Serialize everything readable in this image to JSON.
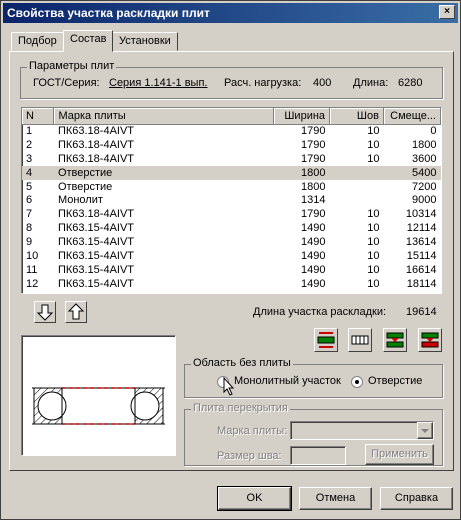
{
  "window": {
    "title": "Свойства участка раскладки плит",
    "close_label": "×"
  },
  "tabs": [
    {
      "label": "Подбор"
    },
    {
      "label": "Состав"
    },
    {
      "label": "Установки"
    }
  ],
  "params": {
    "legend": "Параметры плит",
    "gost_label": "ГОСТ/Серия:",
    "gost_value": "Серия 1.141-1 вып.",
    "load_label": "Расч. нагрузка:",
    "load_value": "400",
    "length_label": "Длина:",
    "length_value": "6280"
  },
  "table": {
    "headers": [
      "N",
      "Марка плиты",
      "Ширина",
      "Шов",
      "Смеще..."
    ],
    "rows": [
      [
        "1",
        "ПК63.18-4AIVT",
        "1790",
        "10",
        "0"
      ],
      [
        "2",
        "ПК63.18-4AIVT",
        "1790",
        "10",
        "1800"
      ],
      [
        "3",
        "ПК63.18-4AIVT",
        "1790",
        "10",
        "3600"
      ],
      [
        "4",
        "Отверстие",
        "1800",
        "",
        "5400"
      ],
      [
        "5",
        "Отверстие",
        "1800",
        "",
        "7200"
      ],
      [
        "6",
        "Монолит",
        "1314",
        "",
        "9000"
      ],
      [
        "7",
        "ПК63.18-4AIVT",
        "1790",
        "10",
        "10314"
      ],
      [
        "8",
        "ПК63.15-4AIVT",
        "1490",
        "10",
        "12114"
      ],
      [
        "9",
        "ПК63.15-4AIVT",
        "1490",
        "10",
        "13614"
      ],
      [
        "10",
        "ПК63.15-4AIVT",
        "1490",
        "10",
        "15114"
      ],
      [
        "11",
        "ПК63.15-4AIVT",
        "1490",
        "10",
        "16614"
      ],
      [
        "12",
        "ПК63.15-4AIVT",
        "1490",
        "10",
        "18114"
      ]
    ],
    "selected_row": 3
  },
  "layout_length": {
    "label": "Длина участка раскладки:",
    "value": "19614"
  },
  "area": {
    "legend": "Область без плиты",
    "option1": "Монолитный участок",
    "option2": "Отверстие",
    "selected": "option2"
  },
  "slab": {
    "legend": "Плита перекрытия",
    "mark_label": "Марка плиты:",
    "seam_label": "Размер шва:",
    "apply_label": "Применить"
  },
  "buttons": {
    "ok": "OK",
    "cancel": "Отмена",
    "help": "Справка"
  },
  "icons": {
    "move_down": "arrow-down-icon",
    "move_up": "arrow-up-icon",
    "colors": {
      "red": "#cc0000",
      "green": "#008000"
    }
  }
}
